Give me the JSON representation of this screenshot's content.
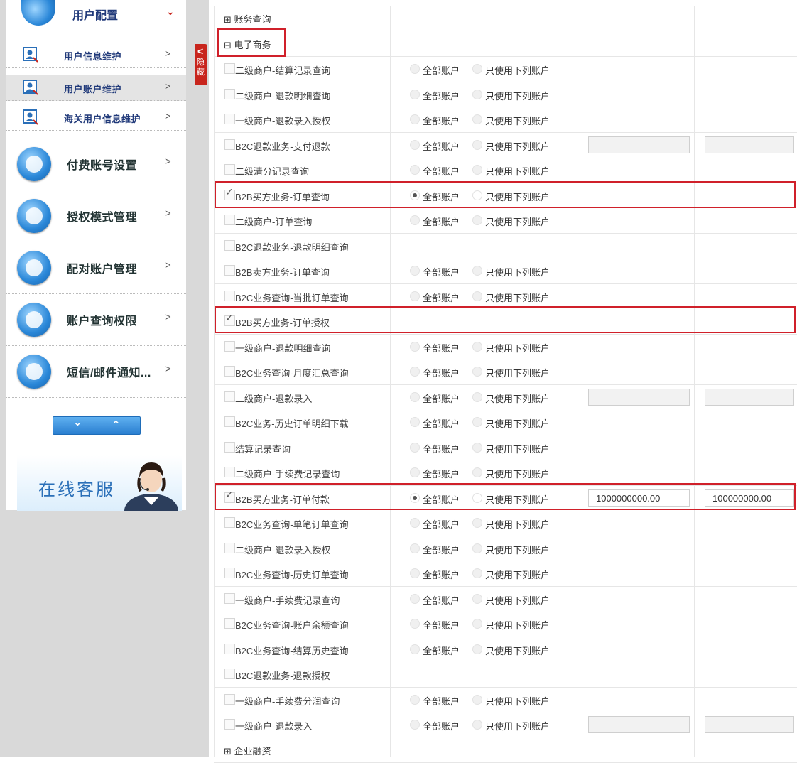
{
  "sidebar": {
    "top_item": {
      "label": "用户配置"
    },
    "sub_items": [
      {
        "label": "用户信息维护",
        "icon": "user-info-icon"
      },
      {
        "label": "用户账户维护",
        "icon": "user-account-icon"
      },
      {
        "label": "海关用户信息维护",
        "icon": "customs-user-icon"
      }
    ],
    "main_items": [
      {
        "label": "付费账号设置",
        "icon": "payment-account-icon"
      },
      {
        "label": "授权模式管理",
        "icon": "authorization-mode-icon"
      },
      {
        "label": "配对账户管理",
        "icon": "paired-account-icon"
      },
      {
        "label": "账户查询权限",
        "icon": "account-query-icon"
      },
      {
        "label": "短信/邮件通知...",
        "icon": "sms-email-icon"
      }
    ],
    "chevron": ">",
    "updown": {
      "down": "⌄",
      "up": "⌃"
    },
    "online_service": "在线客服"
  },
  "hide_tab": {
    "arrow": "<",
    "text1": "隐",
    "text2": "藏"
  },
  "radio_labels": {
    "all": "全部账户",
    "only": "只使用下列账户"
  },
  "table": {
    "group_account_query": "⊞ 账务查询",
    "group_ecommerce": "⊟ 电子商务",
    "group_enterprise_finance": "⊞ 企业融资",
    "rows": [
      {
        "label": "二级商户-结算记录查询",
        "checked": false,
        "radio": true,
        "selected": "none",
        "inputs": false
      },
      {
        "label": "二级商户-退款明细查询",
        "checked": false,
        "radio": true,
        "selected": "none",
        "inputs": false
      },
      {
        "label": "一级商户-退款录入授权",
        "checked": false,
        "radio": true,
        "selected": "none",
        "inputs": false
      },
      {
        "label": "B2C退款业务-支付退款",
        "checked": false,
        "radio": true,
        "selected": "none",
        "inputs": true
      },
      {
        "label": "二级清分记录查询",
        "checked": false,
        "radio": true,
        "selected": "none",
        "inputs": false
      },
      {
        "label": "B2B买方业务-订单查询",
        "checked": true,
        "radio": true,
        "selected": "all",
        "inputs": false
      },
      {
        "label": "二级商户-订单查询",
        "checked": false,
        "radio": true,
        "selected": "none",
        "inputs": false
      },
      {
        "label": "B2C退款业务-退款明细查询",
        "checked": false,
        "radio": false,
        "selected": "none",
        "inputs": false
      },
      {
        "label": "B2B卖方业务-订单查询",
        "checked": false,
        "radio": true,
        "selected": "none",
        "inputs": false
      },
      {
        "label": "B2C业务查询-当批订单查询",
        "checked": false,
        "radio": true,
        "selected": "none",
        "inputs": false
      },
      {
        "label": "B2B买方业务-订单授权",
        "checked": true,
        "radio": false,
        "selected": "none",
        "inputs": false
      },
      {
        "label": "一级商户-退款明细查询",
        "checked": false,
        "radio": true,
        "selected": "none",
        "inputs": false
      },
      {
        "label": "B2C业务查询-月度汇总查询",
        "checked": false,
        "radio": true,
        "selected": "none",
        "inputs": false
      },
      {
        "label": "二级商户-退款录入",
        "checked": false,
        "radio": true,
        "selected": "none",
        "inputs": true
      },
      {
        "label": "B2C业务-历史订单明细下载",
        "checked": false,
        "radio": true,
        "selected": "none",
        "inputs": false
      },
      {
        "label": "结算记录查询",
        "checked": false,
        "radio": true,
        "selected": "none",
        "inputs": false
      },
      {
        "label": "二级商户-手续费记录查询",
        "checked": false,
        "radio": true,
        "selected": "none",
        "inputs": false
      },
      {
        "label": "B2B买方业务-订单付款",
        "checked": true,
        "radio": true,
        "selected": "all",
        "inputs": true,
        "value1": "1000000000.00",
        "value2": "100000000.00"
      },
      {
        "label": "B2C业务查询-单笔订单查询",
        "checked": false,
        "radio": true,
        "selected": "none",
        "inputs": false
      },
      {
        "label": "二级商户-退款录入授权",
        "checked": false,
        "radio": true,
        "selected": "none",
        "inputs": false
      },
      {
        "label": "B2C业务查询-历史订单查询",
        "checked": false,
        "radio": true,
        "selected": "none",
        "inputs": false
      },
      {
        "label": "一级商户-手续费记录查询",
        "checked": false,
        "radio": true,
        "selected": "none",
        "inputs": false
      },
      {
        "label": "B2C业务查询-账户余额查询",
        "checked": false,
        "radio": true,
        "selected": "none",
        "inputs": false
      },
      {
        "label": "B2C业务查询-结算历史查询",
        "checked": false,
        "radio": true,
        "selected": "none",
        "inputs": false
      },
      {
        "label": "B2C退款业务-退款授权",
        "checked": false,
        "radio": false,
        "selected": "none",
        "inputs": false
      },
      {
        "label": "一级商户-手续费分润查询",
        "checked": false,
        "radio": true,
        "selected": "none",
        "inputs": false
      },
      {
        "label": "一级商户-退款录入",
        "checked": false,
        "radio": true,
        "selected": "none",
        "inputs": true
      }
    ]
  },
  "colors": {
    "highlight": "#d0202a",
    "accent": "#2a7fd0",
    "hide_tab": "#c8251d"
  }
}
